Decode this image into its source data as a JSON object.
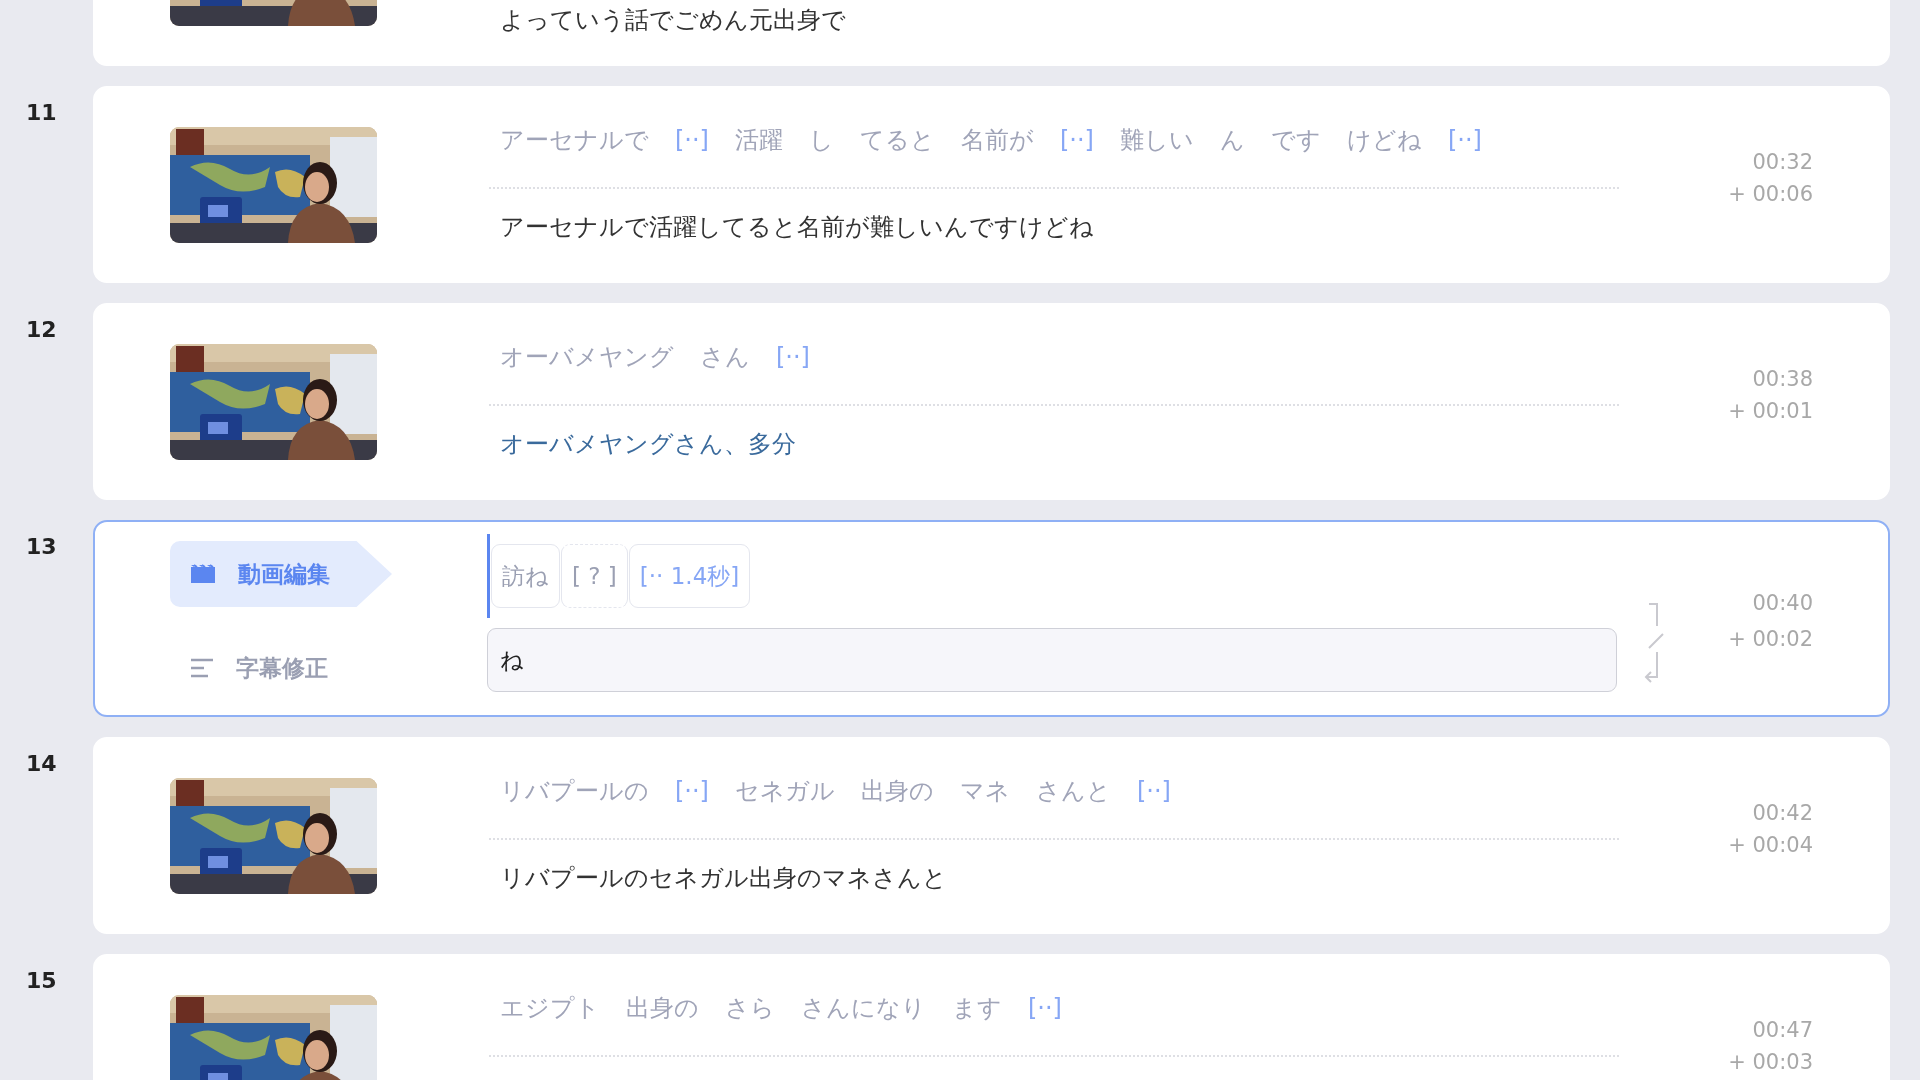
{
  "rows": [
    {
      "kind": "view",
      "thumbnail": {
        "kind": "picture"
      },
      "subtitle": "よっていう話でごめん元出身で",
      "edited": false
    },
    {
      "kind": "view",
      "number": "11",
      "thumbnail": {
        "kind": "picture"
      },
      "tokens": [
        {
          "kind": "word",
          "text": "アーセナルで"
        },
        {
          "kind": "gap",
          "text": "[··]"
        },
        {
          "kind": "word",
          "text": "活躍"
        },
        {
          "kind": "word",
          "text": "し"
        },
        {
          "kind": "word",
          "text": "てると"
        },
        {
          "kind": "word",
          "text": "名前が"
        },
        {
          "kind": "gap",
          "text": "[··]"
        },
        {
          "kind": "word",
          "text": "難しい"
        },
        {
          "kind": "word",
          "text": "ん"
        },
        {
          "kind": "word",
          "text": "です"
        },
        {
          "kind": "word",
          "text": "けどね"
        },
        {
          "kind": "gap",
          "text": "[··]"
        }
      ],
      "subtitle": "アーセナルで活躍してると名前が難しいんですけどね",
      "edited": false,
      "start": "00:32",
      "duration": "+ 00:06"
    },
    {
      "kind": "view",
      "number": "12",
      "thumbnail": {
        "kind": "picture"
      },
      "tokens": [
        {
          "kind": "word",
          "text": "オーバメヤング"
        },
        {
          "kind": "word",
          "text": "さん"
        },
        {
          "kind": "gap",
          "text": "[··]"
        }
      ],
      "subtitle": "オーバメヤングさん、多分",
      "edited": true,
      "start": "00:38",
      "duration": "+ 00:01"
    },
    {
      "kind": "edit",
      "number": "13",
      "modes": [
        {
          "label": "動画編集",
          "selected": true
        },
        {
          "label": "字幕修正",
          "selected": false
        }
      ],
      "tokens": [
        {
          "kind": "word",
          "text": "訪ね"
        },
        {
          "kind": "unknown",
          "text": "[ ? ]"
        },
        {
          "kind": "gap",
          "text": "[·· 1.4秒]"
        }
      ],
      "input": {
        "value": "ね"
      },
      "start": "00:40",
      "duration": "+ 00:02"
    },
    {
      "kind": "view",
      "number": "14",
      "thumbnail": {
        "kind": "picture"
      },
      "tokens": [
        {
          "kind": "word",
          "text": "リバプールの"
        },
        {
          "kind": "gap",
          "text": "[··]"
        },
        {
          "kind": "word",
          "text": "セネガル"
        },
        {
          "kind": "word",
          "text": "出身の"
        },
        {
          "kind": "word",
          "text": "マネ"
        },
        {
          "kind": "word",
          "text": "さんと"
        },
        {
          "kind": "gap",
          "text": "[··]"
        }
      ],
      "subtitle": "リバプールのセネガル出身のマネさんと",
      "edited": false,
      "start": "00:42",
      "duration": "+ 00:04"
    },
    {
      "kind": "view",
      "number": "15",
      "thumbnail": {
        "kind": "picture"
      },
      "tokens": [
        {
          "kind": "word",
          "text": "エジプト"
        },
        {
          "kind": "word",
          "text": "出身の"
        },
        {
          "kind": "word",
          "text": "さら"
        },
        {
          "kind": "word",
          "text": "さんになり"
        },
        {
          "kind": "word",
          "text": "ます"
        },
        {
          "kind": "gap",
          "text": "[··]"
        }
      ],
      "start": "00:47",
      "duration": "+ 00:03"
    }
  ]
}
